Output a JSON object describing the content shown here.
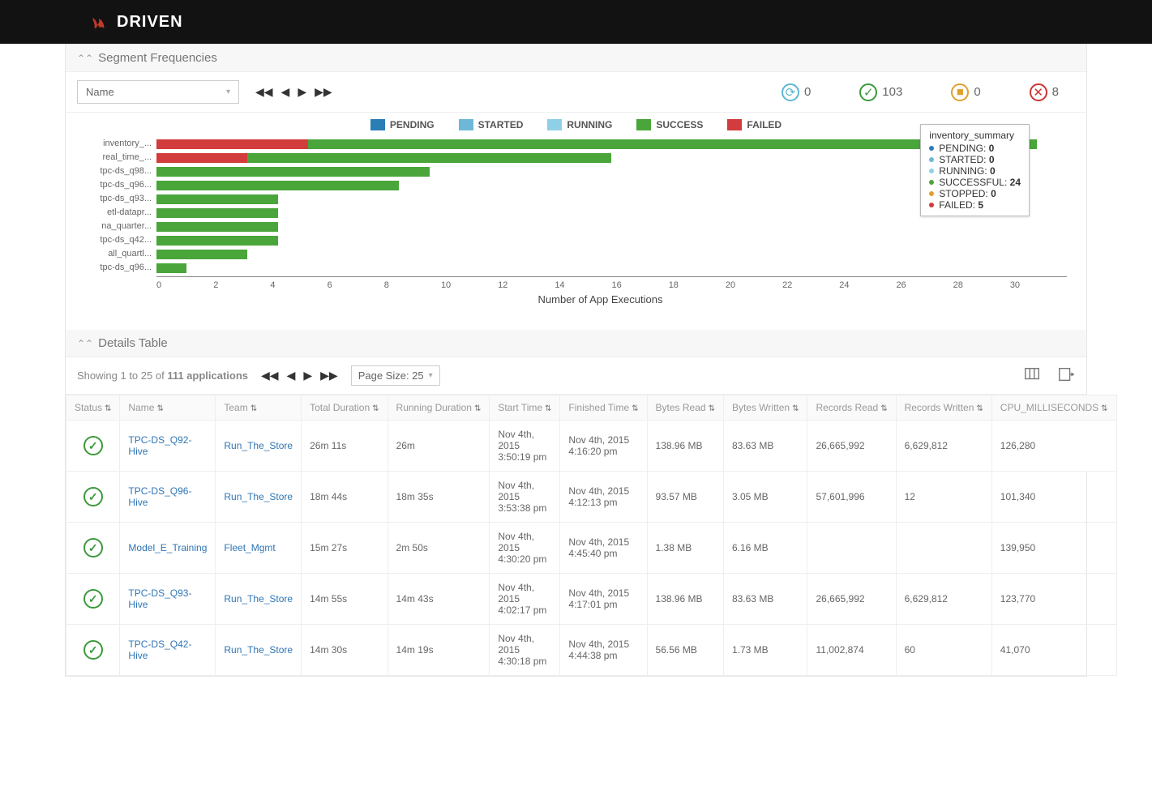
{
  "brand": "DRIVEN",
  "sections": {
    "chart_title": "Segment Frequencies",
    "details_title": "Details Table"
  },
  "filter_select": {
    "label": "Name"
  },
  "status_counts": {
    "pending": 0,
    "success": 103,
    "stopped": 0,
    "failed": 8
  },
  "legend": {
    "pending": "PENDING",
    "started": "STARTED",
    "running": "RUNNING",
    "success": "SUCCESS",
    "failed": "FAILED"
  },
  "legend_colors": {
    "pending": "#2b7db5",
    "started": "#6fb7d6",
    "running": "#8fd0e6",
    "success": "#4aa53a",
    "stopped": "#e0a030",
    "failed": "#d23c3c"
  },
  "tooltip": {
    "title": "inventory_summary",
    "rows": [
      {
        "label": "PENDING",
        "val": "0",
        "color": "#2b7db5"
      },
      {
        "label": "STARTED",
        "val": "0",
        "color": "#6fb7d6"
      },
      {
        "label": "RUNNING",
        "val": "0",
        "color": "#8fd0e6"
      },
      {
        "label": "SUCCESSFUL",
        "val": "24",
        "color": "#4aa53a"
      },
      {
        "label": "STOPPED",
        "val": "0",
        "color": "#e0a030"
      },
      {
        "label": "FAILED",
        "val": "5",
        "color": "#d23c3c"
      }
    ]
  },
  "chart_data": {
    "type": "bar",
    "orientation": "horizontal",
    "stacked": true,
    "xlabel": "Number of App Executions",
    "xlim": [
      0,
      30
    ],
    "xticks": [
      0,
      2,
      4,
      6,
      8,
      10,
      12,
      14,
      16,
      18,
      20,
      22,
      24,
      26,
      28,
      30
    ],
    "categories": [
      "inventory_...",
      "real_time_...",
      "tpc-ds_q98...",
      "tpc-ds_q96...",
      "tpc-ds_q93...",
      "etl-datapr...",
      "na_quarter...",
      "tpc-ds_q42...",
      "all_quartl...",
      "tpc-ds_q96..."
    ],
    "series": [
      {
        "name": "FAILED",
        "color": "#d23c3c",
        "values": [
          5,
          3,
          0,
          0,
          0,
          0,
          0,
          0,
          0,
          0
        ]
      },
      {
        "name": "SUCCESSFUL",
        "color": "#4aa53a",
        "values": [
          24,
          12,
          9,
          8,
          4,
          4,
          4,
          4,
          3,
          1
        ]
      }
    ]
  },
  "details": {
    "showing_text_pre": "Showing 1 to 25 of ",
    "showing_text_bold": "111 applications",
    "page_size_label": "Page Size: 25"
  },
  "table": {
    "headers": [
      "Status",
      "Name",
      "Team",
      "Total Duration",
      "Running Duration",
      "Start Time",
      "Finished Time",
      "Bytes Read",
      "Bytes Written",
      "Records Read",
      "Records Written",
      "CPU_MILLISECONDS"
    ],
    "rows": [
      {
        "status": "success",
        "name": "TPC-DS_Q92-Hive",
        "team": "Run_The_Store",
        "total": "26m 11s",
        "running": "26m",
        "start": "Nov 4th, 2015 3:50:19 pm",
        "finish": "Nov 4th, 2015 4:16:20 pm",
        "bread": "138.96 MB",
        "bwrit": "83.63 MB",
        "rread": "26,665,992",
        "rwrit": "6,629,812",
        "cpu": "126,280"
      },
      {
        "status": "success",
        "name": "TPC-DS_Q96-Hive",
        "team": "Run_The_Store",
        "total": "18m 44s",
        "running": "18m 35s",
        "start": "Nov 4th, 2015 3:53:38 pm",
        "finish": "Nov 4th, 2015 4:12:13 pm",
        "bread": "93.57 MB",
        "bwrit": "3.05 MB",
        "rread": "57,601,996",
        "rwrit": "12",
        "cpu": "101,340"
      },
      {
        "status": "success",
        "name": "Model_E_Training",
        "team": "Fleet_Mgmt",
        "total": "15m 27s",
        "running": "2m 50s",
        "start": "Nov 4th, 2015 4:30:20 pm",
        "finish": "Nov 4th, 2015 4:45:40 pm",
        "bread": "1.38 MB",
        "bwrit": "6.16 MB",
        "rread": "",
        "rwrit": "",
        "cpu": "139,950"
      },
      {
        "status": "success",
        "name": "TPC-DS_Q93-Hive",
        "team": "Run_The_Store",
        "total": "14m 55s",
        "running": "14m 43s",
        "start": "Nov 4th, 2015 4:02:17 pm",
        "finish": "Nov 4th, 2015 4:17:01 pm",
        "bread": "138.96 MB",
        "bwrit": "83.63 MB",
        "rread": "26,665,992",
        "rwrit": "6,629,812",
        "cpu": "123,770"
      },
      {
        "status": "success",
        "name": "TPC-DS_Q42-Hive",
        "team": "Run_The_Store",
        "total": "14m 30s",
        "running": "14m 19s",
        "start": "Nov 4th, 2015 4:30:18 pm",
        "finish": "Nov 4th, 2015 4:44:38 pm",
        "bread": "56.56 MB",
        "bwrit": "1.73 MB",
        "rread": "11,002,874",
        "rwrit": "60",
        "cpu": "41,070"
      }
    ]
  }
}
